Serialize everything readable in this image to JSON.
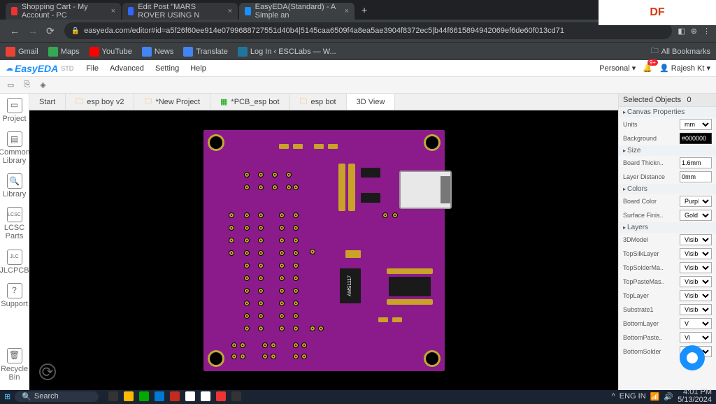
{
  "browser": {
    "tabs": [
      {
        "title": "Shopping Cart - My Account - PC"
      },
      {
        "title": "Edit Post \"MARS ROVER USING N"
      },
      {
        "title": "EasyEDA(Standard) - A Simple an"
      }
    ],
    "url": "easyeda.com/editor#id=a5f26f60ee914e0799688727551d40b4|5145caa6509f4a8ea5ae3904f8372ec5|b44f6615894942069ef6de60f013cd71"
  },
  "bookmarks": [
    {
      "label": "Gmail"
    },
    {
      "label": "Maps"
    },
    {
      "label": "YouTube"
    },
    {
      "label": "News"
    },
    {
      "label": "Translate"
    },
    {
      "label": "Log In ‹ ESCLabs — W..."
    }
  ],
  "all_bookmarks": "All Bookmarks",
  "app_menu": {
    "logo": "EasyEDA",
    "std": "STD",
    "items": [
      "File",
      "Advanced",
      "Setting",
      "Help"
    ],
    "personal": "Personal",
    "user": "Rajesh Kt",
    "notif": "9+"
  },
  "rail": [
    {
      "label": "Project"
    },
    {
      "label": "Common Library"
    },
    {
      "label": "Library"
    },
    {
      "label": "LCSC Parts"
    },
    {
      "label": "JLCPCB"
    },
    {
      "label": "Support"
    },
    {
      "label": "Recycle Bin"
    }
  ],
  "doc_tabs": [
    {
      "label": "Start"
    },
    {
      "label": "esp boy v2"
    },
    {
      "label": "*New Project"
    },
    {
      "label": "*PCB_esp bot"
    },
    {
      "label": "esp bot"
    },
    {
      "label": "3D View"
    }
  ],
  "pcb_chip": "AMS1117",
  "right": {
    "selected": "Selected Objects",
    "selected_count": "0",
    "canvas": "Canvas Properties",
    "units_l": "Units",
    "units_v": "mm",
    "bg_l": "Background",
    "bg_v": "#000000",
    "size": "Size",
    "thick_l": "Board Thickn..",
    "thick_v": "1.6mm",
    "ldist_l": "Layer Distance",
    "ldist_v": "0mm",
    "colors": "Colors",
    "bcolor_l": "Board Color",
    "bcolor_v": "Purple",
    "sfin_l": "Surface Finis..",
    "sfin_v": "Gold",
    "layers": "Layers",
    "rows": [
      {
        "l": "3DModel",
        "v": "Visibl"
      },
      {
        "l": "TopSilkLayer",
        "v": "Visibl"
      },
      {
        "l": "TopSolderMa..",
        "v": "Visibl"
      },
      {
        "l": "TopPasteMas..",
        "v": "Visibl"
      },
      {
        "l": "TopLayer",
        "v": "Visibl"
      },
      {
        "l": "Substrate1",
        "v": "Visibl"
      },
      {
        "l": "BottomLayer",
        "v": "V"
      },
      {
        "l": "BottomPaste..",
        "v": "Vi"
      },
      {
        "l": "BottomSolder",
        "v": "Visibl"
      }
    ]
  },
  "taskbar": {
    "search": "Search",
    "time": "4:01 PM",
    "date": "5/13/2024",
    "lang": "ENG IN"
  },
  "df": "DF"
}
